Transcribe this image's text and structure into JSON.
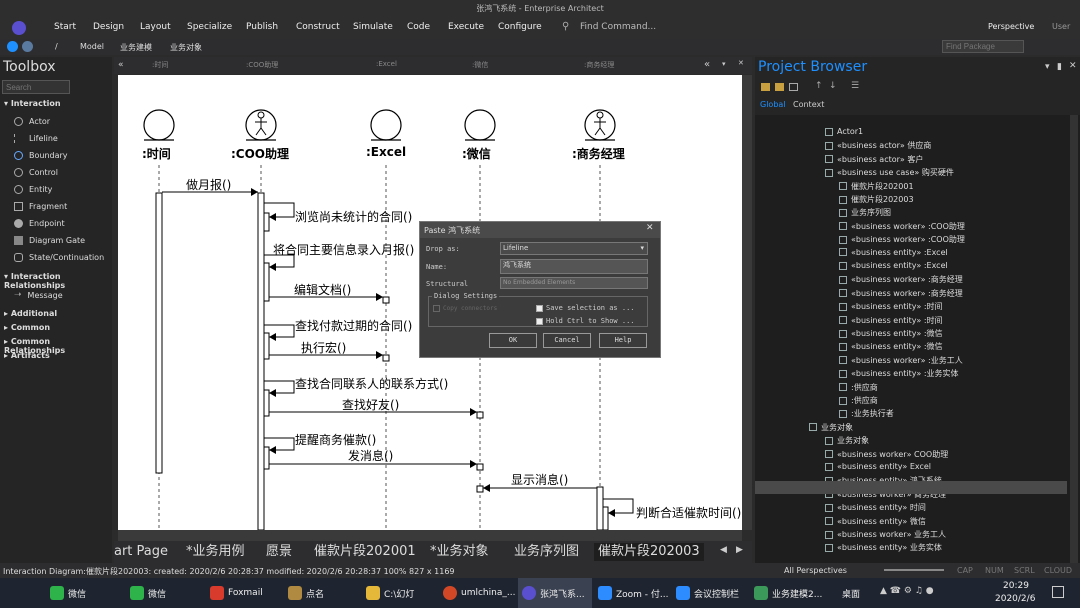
{
  "window": {
    "title": "张鸿飞系统 - Enterprise Architect"
  },
  "ribbon": {
    "menus": [
      "Start",
      "Design",
      "Layout",
      "Specialize",
      "Publish",
      "Construct",
      "Simulate",
      "Code",
      "Execute",
      "Configure"
    ],
    "find_command": "Find Command...",
    "perspective": "Perspective",
    "user": "User"
  },
  "address": {
    "path": [
      "/",
      "Model",
      "业务建模",
      "业务对象"
    ],
    "find_package_placeholder": "Find Package"
  },
  "toolbox": {
    "title": "Toolbox",
    "search_placeholder": "Search",
    "sections": [
      {
        "label": "Interaction",
        "items": [
          "Actor",
          "Lifeline",
          "Boundary",
          "Control",
          "Entity",
          "Fragment",
          "Endpoint",
          "Diagram Gate",
          "State/Continuation"
        ]
      },
      {
        "label": "Interaction Relationships",
        "items": [
          "Message"
        ]
      },
      {
        "label": "Additional",
        "items": []
      },
      {
        "label": "Common",
        "items": []
      },
      {
        "label": "Common Relationships",
        "items": []
      },
      {
        "label": "Artifacts",
        "items": []
      }
    ]
  },
  "diagram": {
    "header_labels": [
      ":时间",
      ":COO助理",
      ":Excel",
      ":微信",
      ":商务经理"
    ],
    "lifelines": [
      ":时间",
      ":COO助理",
      ":Excel",
      ":微信",
      ":商务经理"
    ],
    "messages": [
      "做月报()",
      "浏览尚未统计的合同()",
      "将合同主要信息录入月报()",
      "编辑文档()",
      "查找付款过期的合同()",
      "执行宏()",
      "查找合同联系人的联系方式()",
      "查找好友()",
      "提醒商务催款()",
      "发消息()",
      "显示消息()",
      "判断合适催款时间()"
    ]
  },
  "dialog": {
    "title": "Paste 鸿飞系统",
    "drop_as_label": "Drop as:",
    "drop_as_value": "Lifeline",
    "name_label": "Name:",
    "name_value": "鸿飞系统",
    "structural_label": "Structural",
    "structural_value": "No Embedded Elements",
    "settings_label": "Dialog Settings",
    "copy_connectors": "Copy connectors",
    "save_selection": "Save selection as ...",
    "hold_ctrl": "Hold Ctrl to Show ...",
    "ok": "OK",
    "cancel": "Cancel",
    "help": "Help"
  },
  "tabs": [
    "art Page",
    "*业务用例",
    "愿景",
    "催款片段202001",
    "*业务对象",
    "业务序列图",
    "催款片段202003"
  ],
  "project_browser": {
    "title": "Project Browser",
    "tabs": [
      "Global",
      "Context"
    ],
    "rows": [
      {
        "text": "Actor1",
        "indent": 70
      },
      {
        "text": "«business actor» 供应商",
        "indent": 70
      },
      {
        "text": "«business actor» 客户",
        "indent": 70
      },
      {
        "text": "«business use case» 购买硬件",
        "indent": 70
      },
      {
        "text": "催款片段202001",
        "indent": 84
      },
      {
        "text": "催款片段202003",
        "indent": 84
      },
      {
        "text": "业务序列图",
        "indent": 84
      },
      {
        "text": "«business worker» :COO助理",
        "indent": 84
      },
      {
        "text": "«business worker» :COO助理",
        "indent": 84
      },
      {
        "text": "«business entity» :Excel",
        "indent": 84
      },
      {
        "text": "«business entity» :Excel",
        "indent": 84
      },
      {
        "text": "«business worker» :商务经理",
        "indent": 84
      },
      {
        "text": "«business worker» :商务经理",
        "indent": 84
      },
      {
        "text": "«business entity» :时间",
        "indent": 84
      },
      {
        "text": "«business entity» :时间",
        "indent": 84
      },
      {
        "text": "«business entity» :微信",
        "indent": 84
      },
      {
        "text": "«business entity» :微信",
        "indent": 84
      },
      {
        "text": "«business worker» :业务工人",
        "indent": 84
      },
      {
        "text": "«business entity» :业务实体",
        "indent": 84
      },
      {
        "text": ":供应商",
        "indent": 84
      },
      {
        "text": ":供应商",
        "indent": 84
      },
      {
        "text": ":业务执行者",
        "indent": 84
      },
      {
        "text": "业务对象",
        "indent": 54
      },
      {
        "text": "业务对象",
        "indent": 70
      },
      {
        "text": "«business worker» COO助理",
        "indent": 70
      },
      {
        "text": "«business entity» Excel",
        "indent": 70
      },
      {
        "text": "«business entity» 鸿飞系统",
        "indent": 70
      },
      {
        "text": "«business worker» 商务经理",
        "indent": 70
      },
      {
        "text": "«business entity» 时间",
        "indent": 70
      },
      {
        "text": "«business entity» 微信",
        "indent": 70
      },
      {
        "text": "«business worker» 业务工人",
        "indent": 70
      },
      {
        "text": "«business entity» 业务实体",
        "indent": 70
      }
    ],
    "selected_row": 26
  },
  "status": {
    "left": "Interaction Diagram:催款片段202003:  created: 2020/2/6 20:28:37  modified: 2020/2/6 20:28:37   100%   827 x 1169",
    "perspectives": "All Perspectives",
    "indicators": [
      "CAP",
      "NUM",
      "SCRL",
      "CLOUD"
    ]
  },
  "taskbar": {
    "items": [
      "微信",
      "微信",
      "Foxmail",
      "点名",
      "C:\\幻灯",
      "umlchina_...",
      "张鸿飞系...",
      "Zoom - 付...",
      "会议控制栏",
      "业务建模2..."
    ],
    "desktop": "桌面",
    "time": "20:29",
    "date": "2020/2/6"
  },
  "colors": {
    "accent": "#1e90ff",
    "selection": "#4a4a4a",
    "dark_bg": "#252526"
  }
}
